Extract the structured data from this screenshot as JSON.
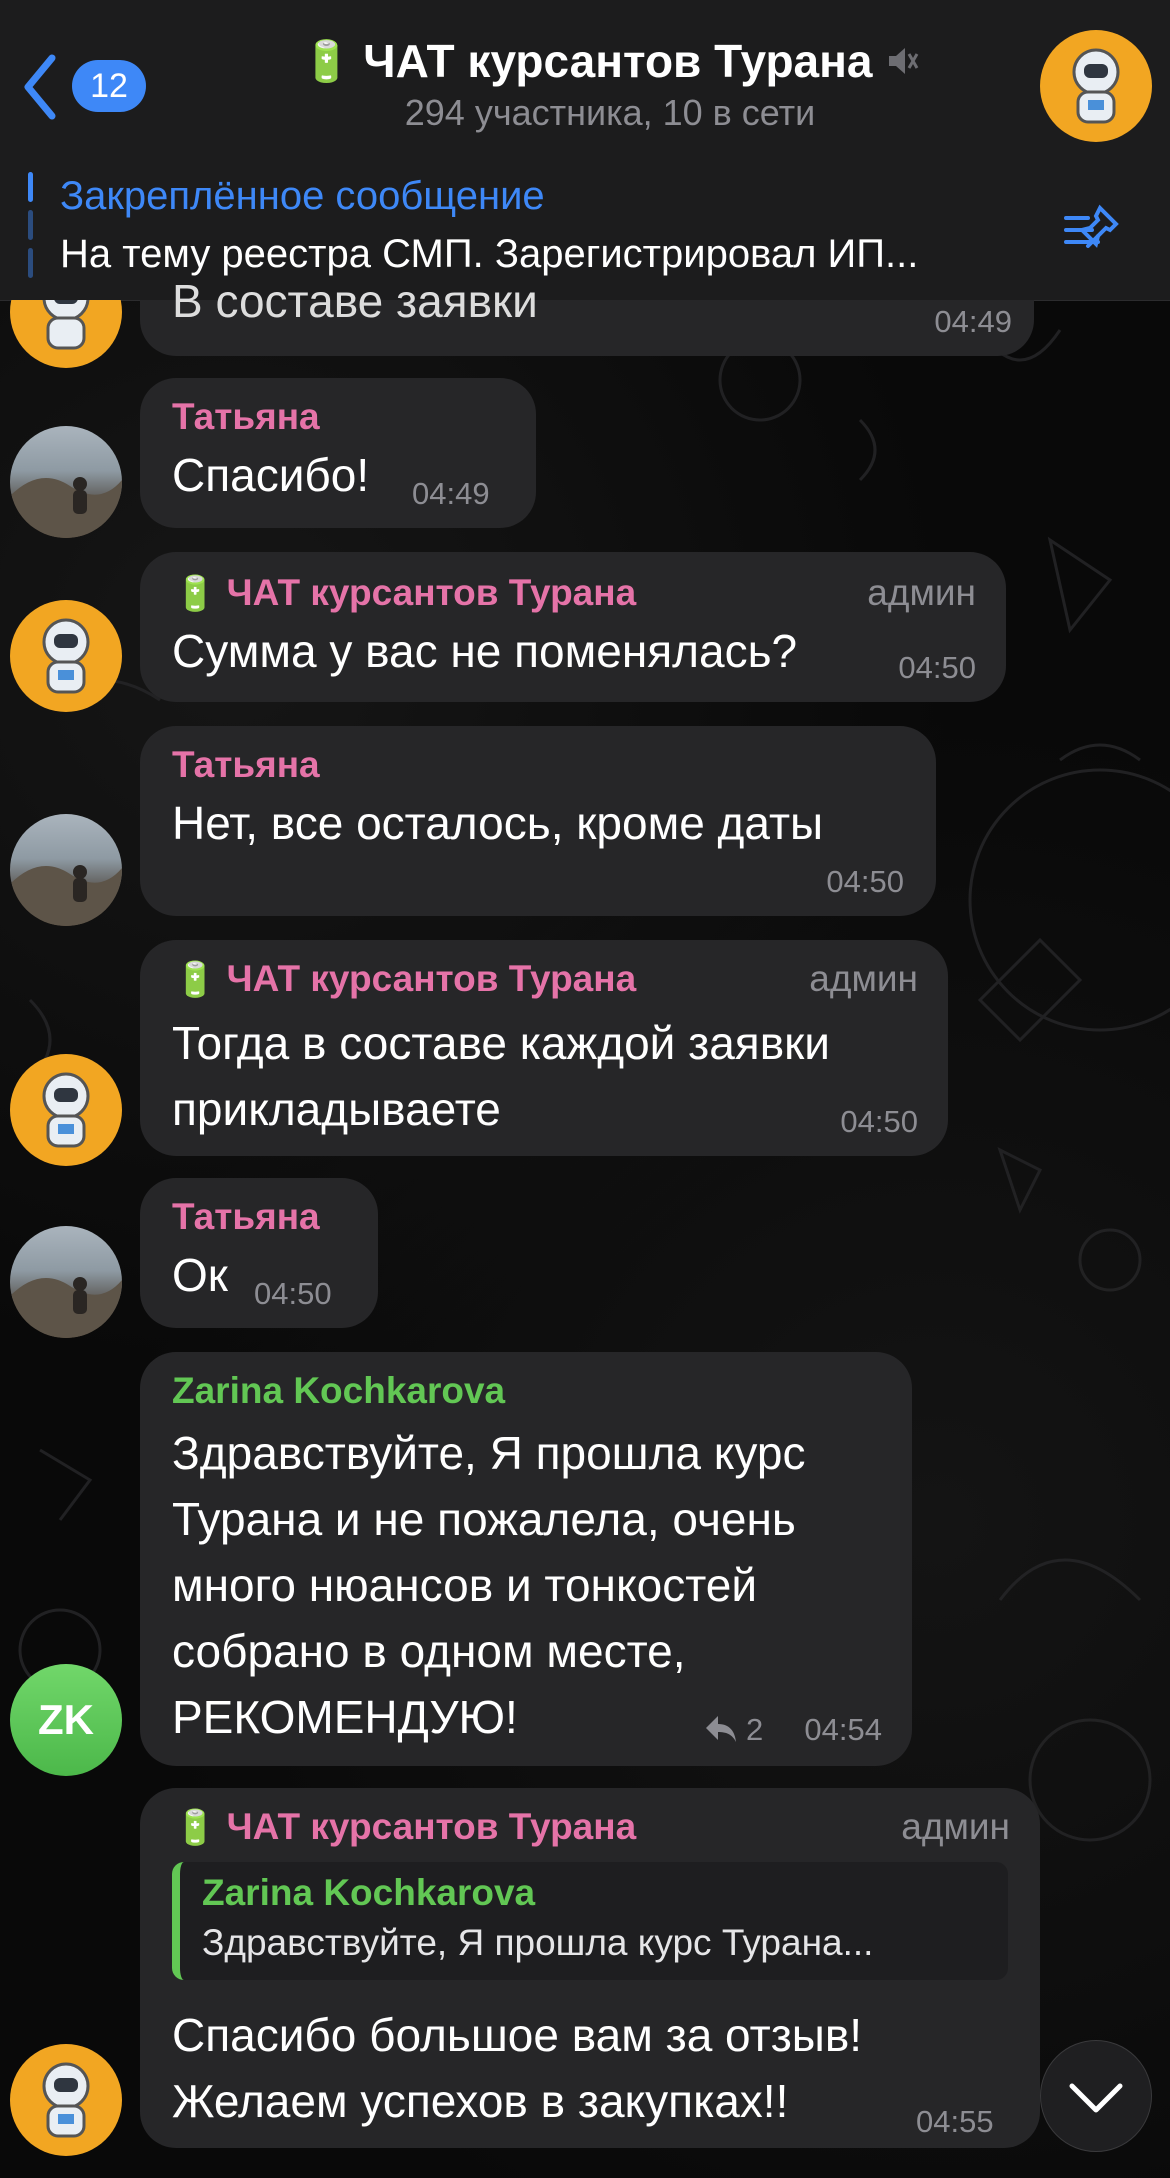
{
  "header": {
    "back_count": "12",
    "title_emoji": "🔋",
    "title": "ЧАТ курсантов Турана",
    "subtitle": "294 участника, 10 в сети",
    "muted_icon": "muted-speaker-icon"
  },
  "pinned": {
    "title": "Закреплённое сообщение",
    "text": "На тему реестра СМП. Зарегистрировал ИП..."
  },
  "messages": [
    {
      "text": "В составе заявки",
      "time": "04:49"
    },
    {
      "sender": "Татьяна",
      "text": "Спасибо!",
      "time": "04:49"
    },
    {
      "sender_emoji": "🔋",
      "sender": "ЧАТ курсантов Турана",
      "role": "админ",
      "text": "Сумма у вас не поменялась?",
      "time": "04:50"
    },
    {
      "sender": "Татьяна",
      "text": "Нет, все осталось, кроме даты",
      "time": "04:50"
    },
    {
      "sender_emoji": "🔋",
      "sender": "ЧАТ курсантов Турана",
      "role": "админ",
      "lines": [
        "Тогда в составе каждой заявки",
        "прикладываете"
      ],
      "time": "04:50"
    },
    {
      "sender": "Татьяна",
      "text": "Ок",
      "time": "04:50"
    },
    {
      "sender": "Zarina Kochkarova",
      "avatar_initials": "ZK",
      "lines": [
        "Здравствуйте, Я прошла курс",
        "Турана и не пожалела, очень",
        "много нюансов и тонкостей",
        "собрано в одном месте,",
        "РЕКОМЕНДУЮ!"
      ],
      "replies": "2",
      "time": "04:54"
    },
    {
      "sender_emoji": "🔋",
      "sender": "ЧАТ курсантов Турана",
      "role": "админ",
      "reply_to": {
        "sender": "Zarina Kochkarova",
        "text": "Здравствуйте, Я прошла курс Турана..."
      },
      "lines": [
        "Спасибо большое вам за отзыв!",
        "Желаем успехов в закупках!!"
      ],
      "time": "04:55"
    }
  ],
  "colors": {
    "accent": "#3e88f7",
    "pink_name": "#e573a8",
    "green_name": "#62c754",
    "bubble": "#262628"
  }
}
